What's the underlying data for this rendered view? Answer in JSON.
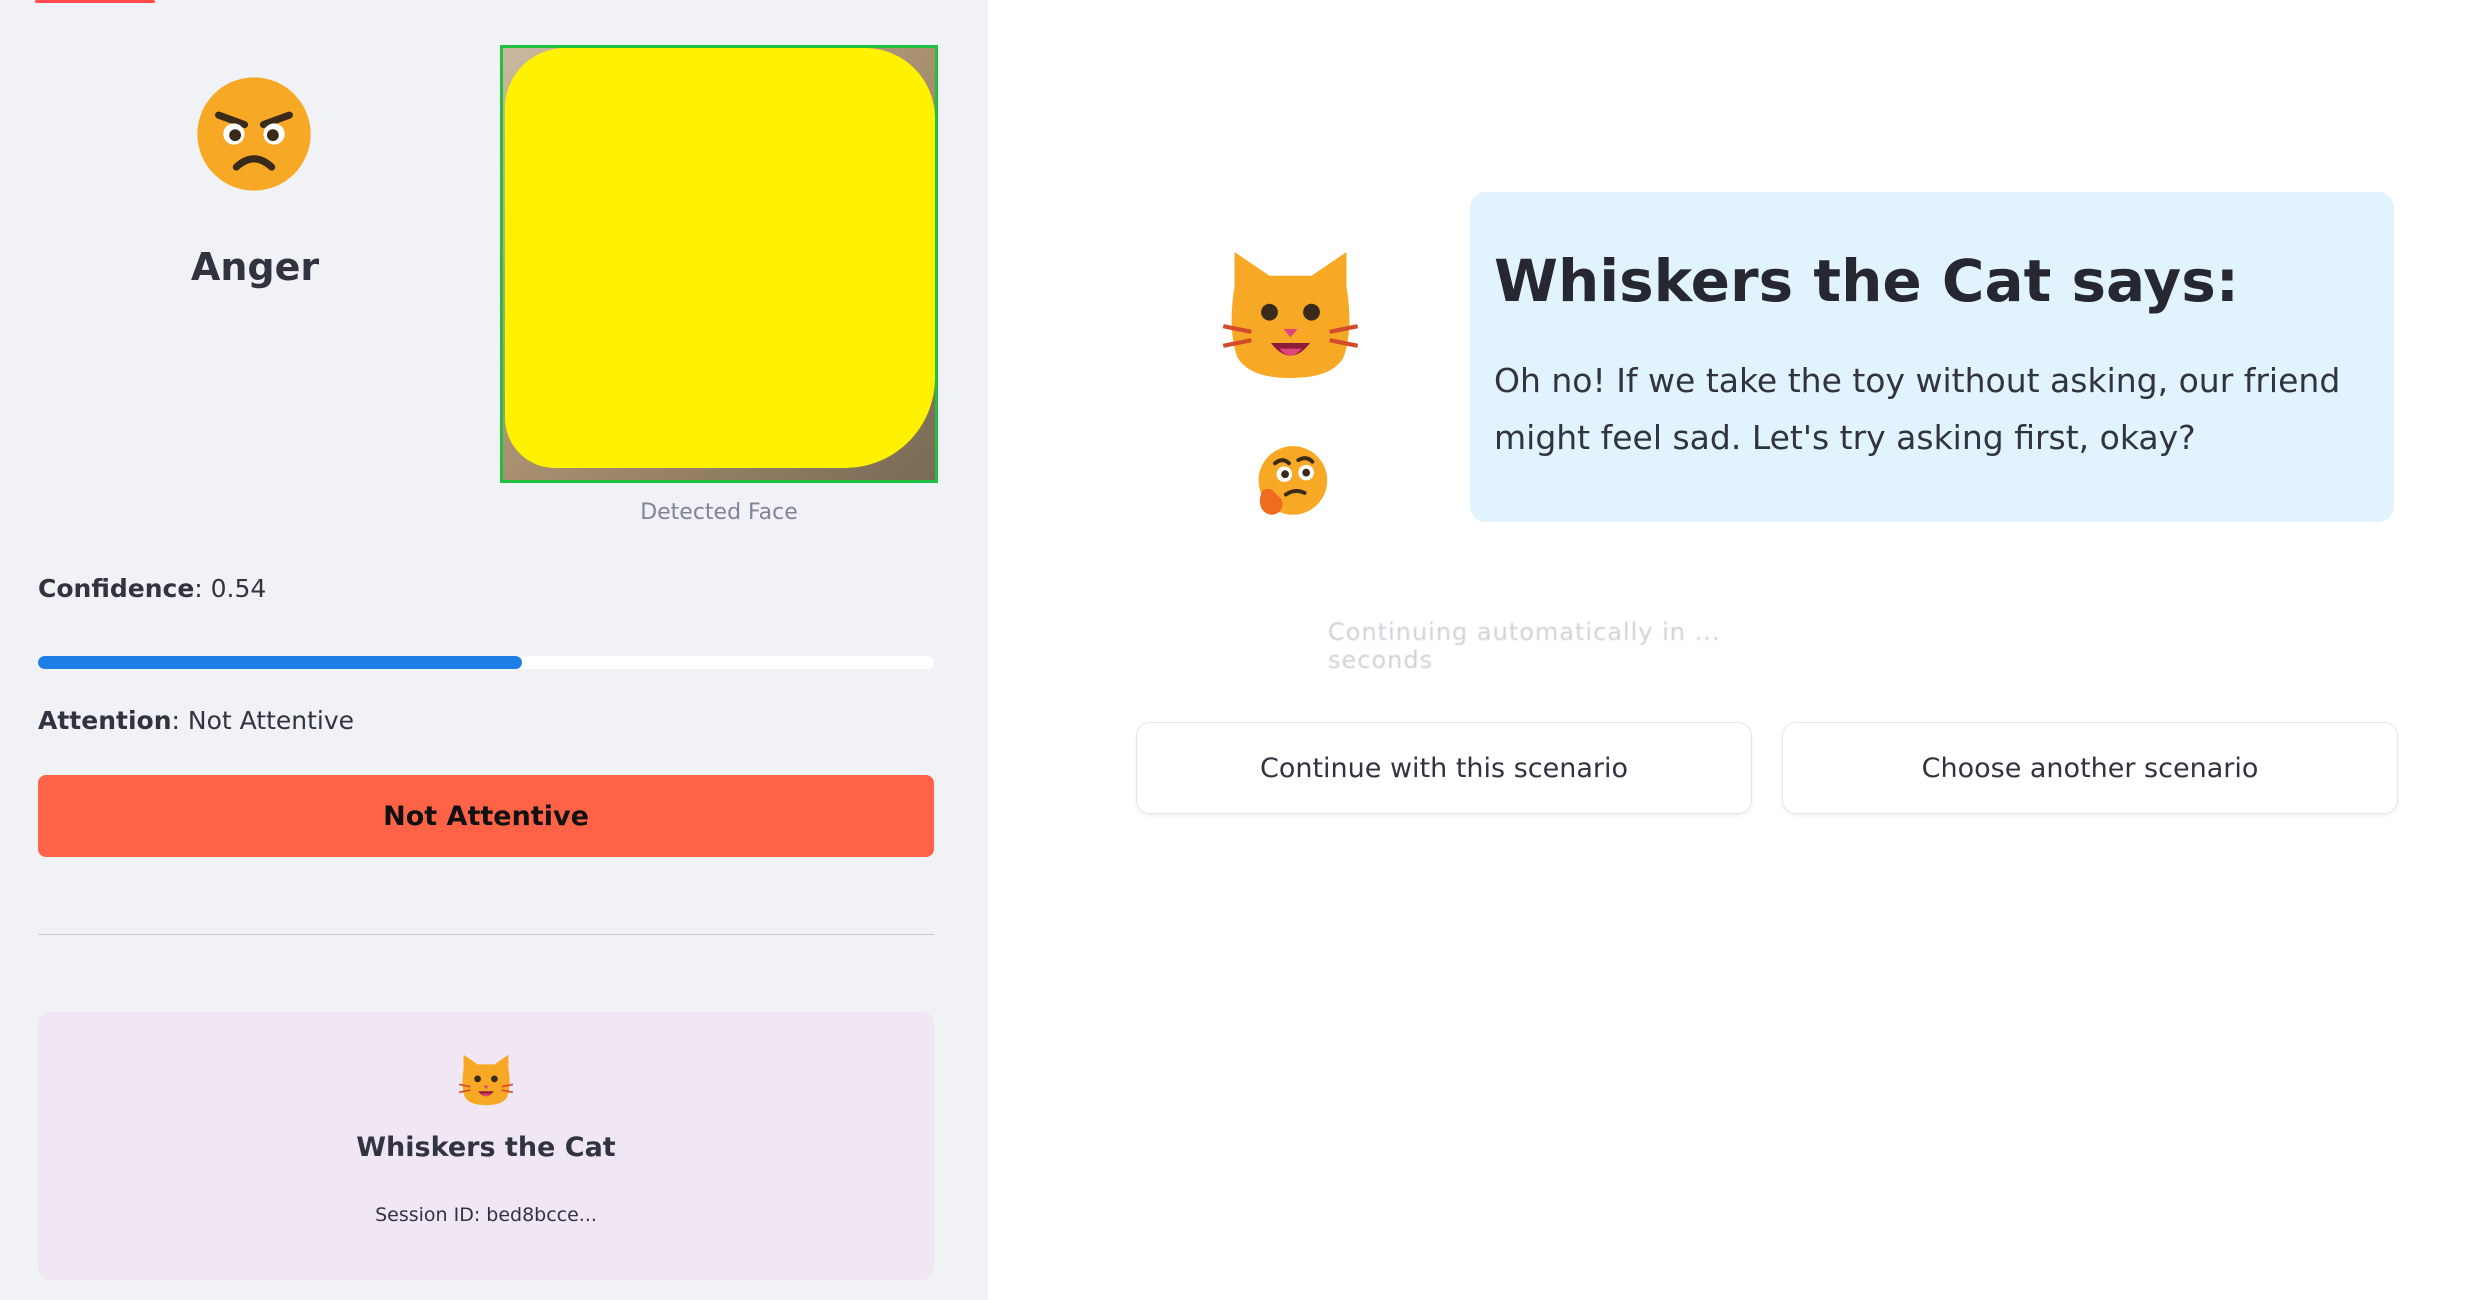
{
  "sidebar": {
    "emotion": {
      "icon": "angry-face-icon",
      "label": "Anger"
    },
    "face_caption": "Detected Face",
    "confidence": {
      "label": "Confidence",
      "value": ": 0.54",
      "fraction": 0.54
    },
    "attention": {
      "label": "Attention",
      "value": ": Not Attentive"
    },
    "status_banner": "Not Attentive",
    "character_card": {
      "icon": "cat-face-icon",
      "name": "Whiskers the Cat",
      "session": "Session ID: bed8bcce..."
    }
  },
  "main": {
    "speech": {
      "title": "Whiskers the Cat says:",
      "text": "Oh no! If we take the toy without asking, our friend might feel sad. Let's try asking first, okay?"
    },
    "faded_status": "Continuing automatically in ... seconds",
    "buttons": {
      "continue": "Continue with this scenario",
      "choose": "Choose another scenario"
    }
  },
  "colors": {
    "sidebar_bg": "#f0f2f6",
    "progress": "#1f7de6",
    "status_banner": "#ff6347",
    "card_bg": "#f1e6f4",
    "speech_bg": "#e1f3fc",
    "face_border": "#21c040"
  }
}
